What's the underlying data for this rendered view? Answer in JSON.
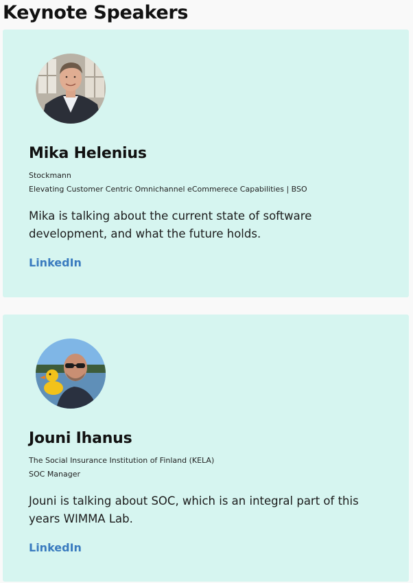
{
  "page": {
    "title": "Keynote Speakers"
  },
  "speakers": [
    {
      "name": "Mika Helenius",
      "organization": "Stockmann",
      "role": "Elevating Customer Centric Omnichannel eCommerece Capabilities | BSO",
      "description": "Mika is talking about the current state of software development, and what the future holds.",
      "link_label": "LinkedIn"
    },
    {
      "name": "Jouni Ihanus",
      "organization": "The Social Insurance Institution of Finland (KELA)",
      "role": "SOC Manager",
      "description": "Jouni is talking about SOC, which is an integral part of this years WIMMA Lab.",
      "link_label": "LinkedIn"
    }
  ],
  "colors": {
    "card_background": "#d6f5f0",
    "link": "#3a7bbf",
    "page_background": "#f9f9f9"
  }
}
